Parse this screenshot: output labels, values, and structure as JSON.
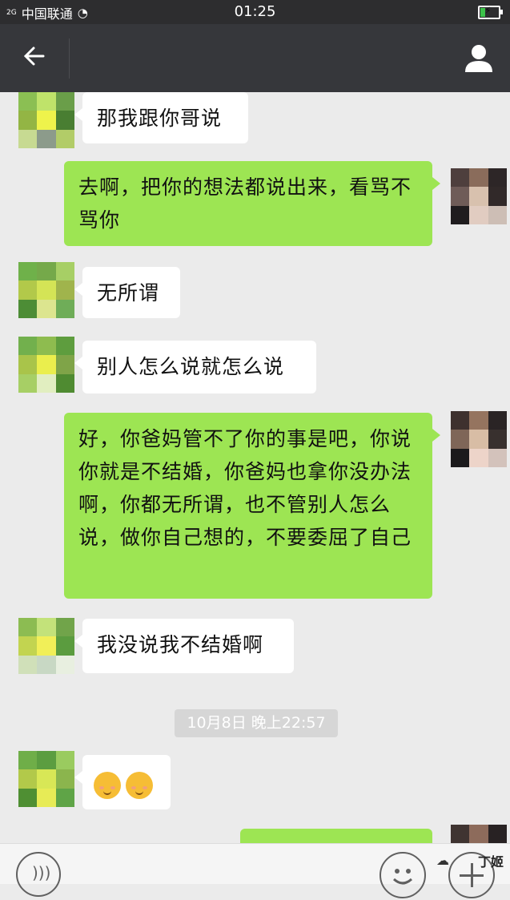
{
  "status_bar": {
    "network": "2G",
    "carrier": "中国联通",
    "time": "01:25",
    "battery_level": 0.25
  },
  "header": {
    "back_icon": "arrow-left-icon",
    "title": "",
    "profile_icon": "person-icon"
  },
  "messages": [
    {
      "side": "left",
      "text": "那我跟你哥说"
    },
    {
      "side": "right",
      "text": "去啊，把你的想法都说出来，看骂不骂你"
    },
    {
      "side": "left",
      "text": "无所谓"
    },
    {
      "side": "left",
      "text": "别人怎么说就怎么说"
    },
    {
      "side": "right",
      "text": "好，你爸妈管不了你的事是吧，你说你就是不结婚，你爸妈也拿你没办法啊，你都无所谓，也不管别人怎么说，做你自己想的，不要委屈了自己"
    },
    {
      "side": "left",
      "text": "我没说我不结婚啊"
    },
    {
      "side": "left",
      "emoji": [
        "smiling-face-emoji",
        "smiling-face-emoji"
      ]
    },
    {
      "side": "right",
      "text": ""
    }
  ],
  "timestamp": "10月8日 晚上22:57",
  "input_bar": {
    "voice_icon": "voice-icon",
    "emoji_icon": "emoji-icon",
    "plus_icon": "plus-icon"
  },
  "watermark": "丁姬",
  "colors": {
    "header_bg": "#36373b",
    "status_bg": "#2d2d2f",
    "chat_bg": "#ebebeb",
    "my_bubble": "#9de553",
    "their_bubble": "#ffffff",
    "battery_fill": "#3cc24a"
  }
}
